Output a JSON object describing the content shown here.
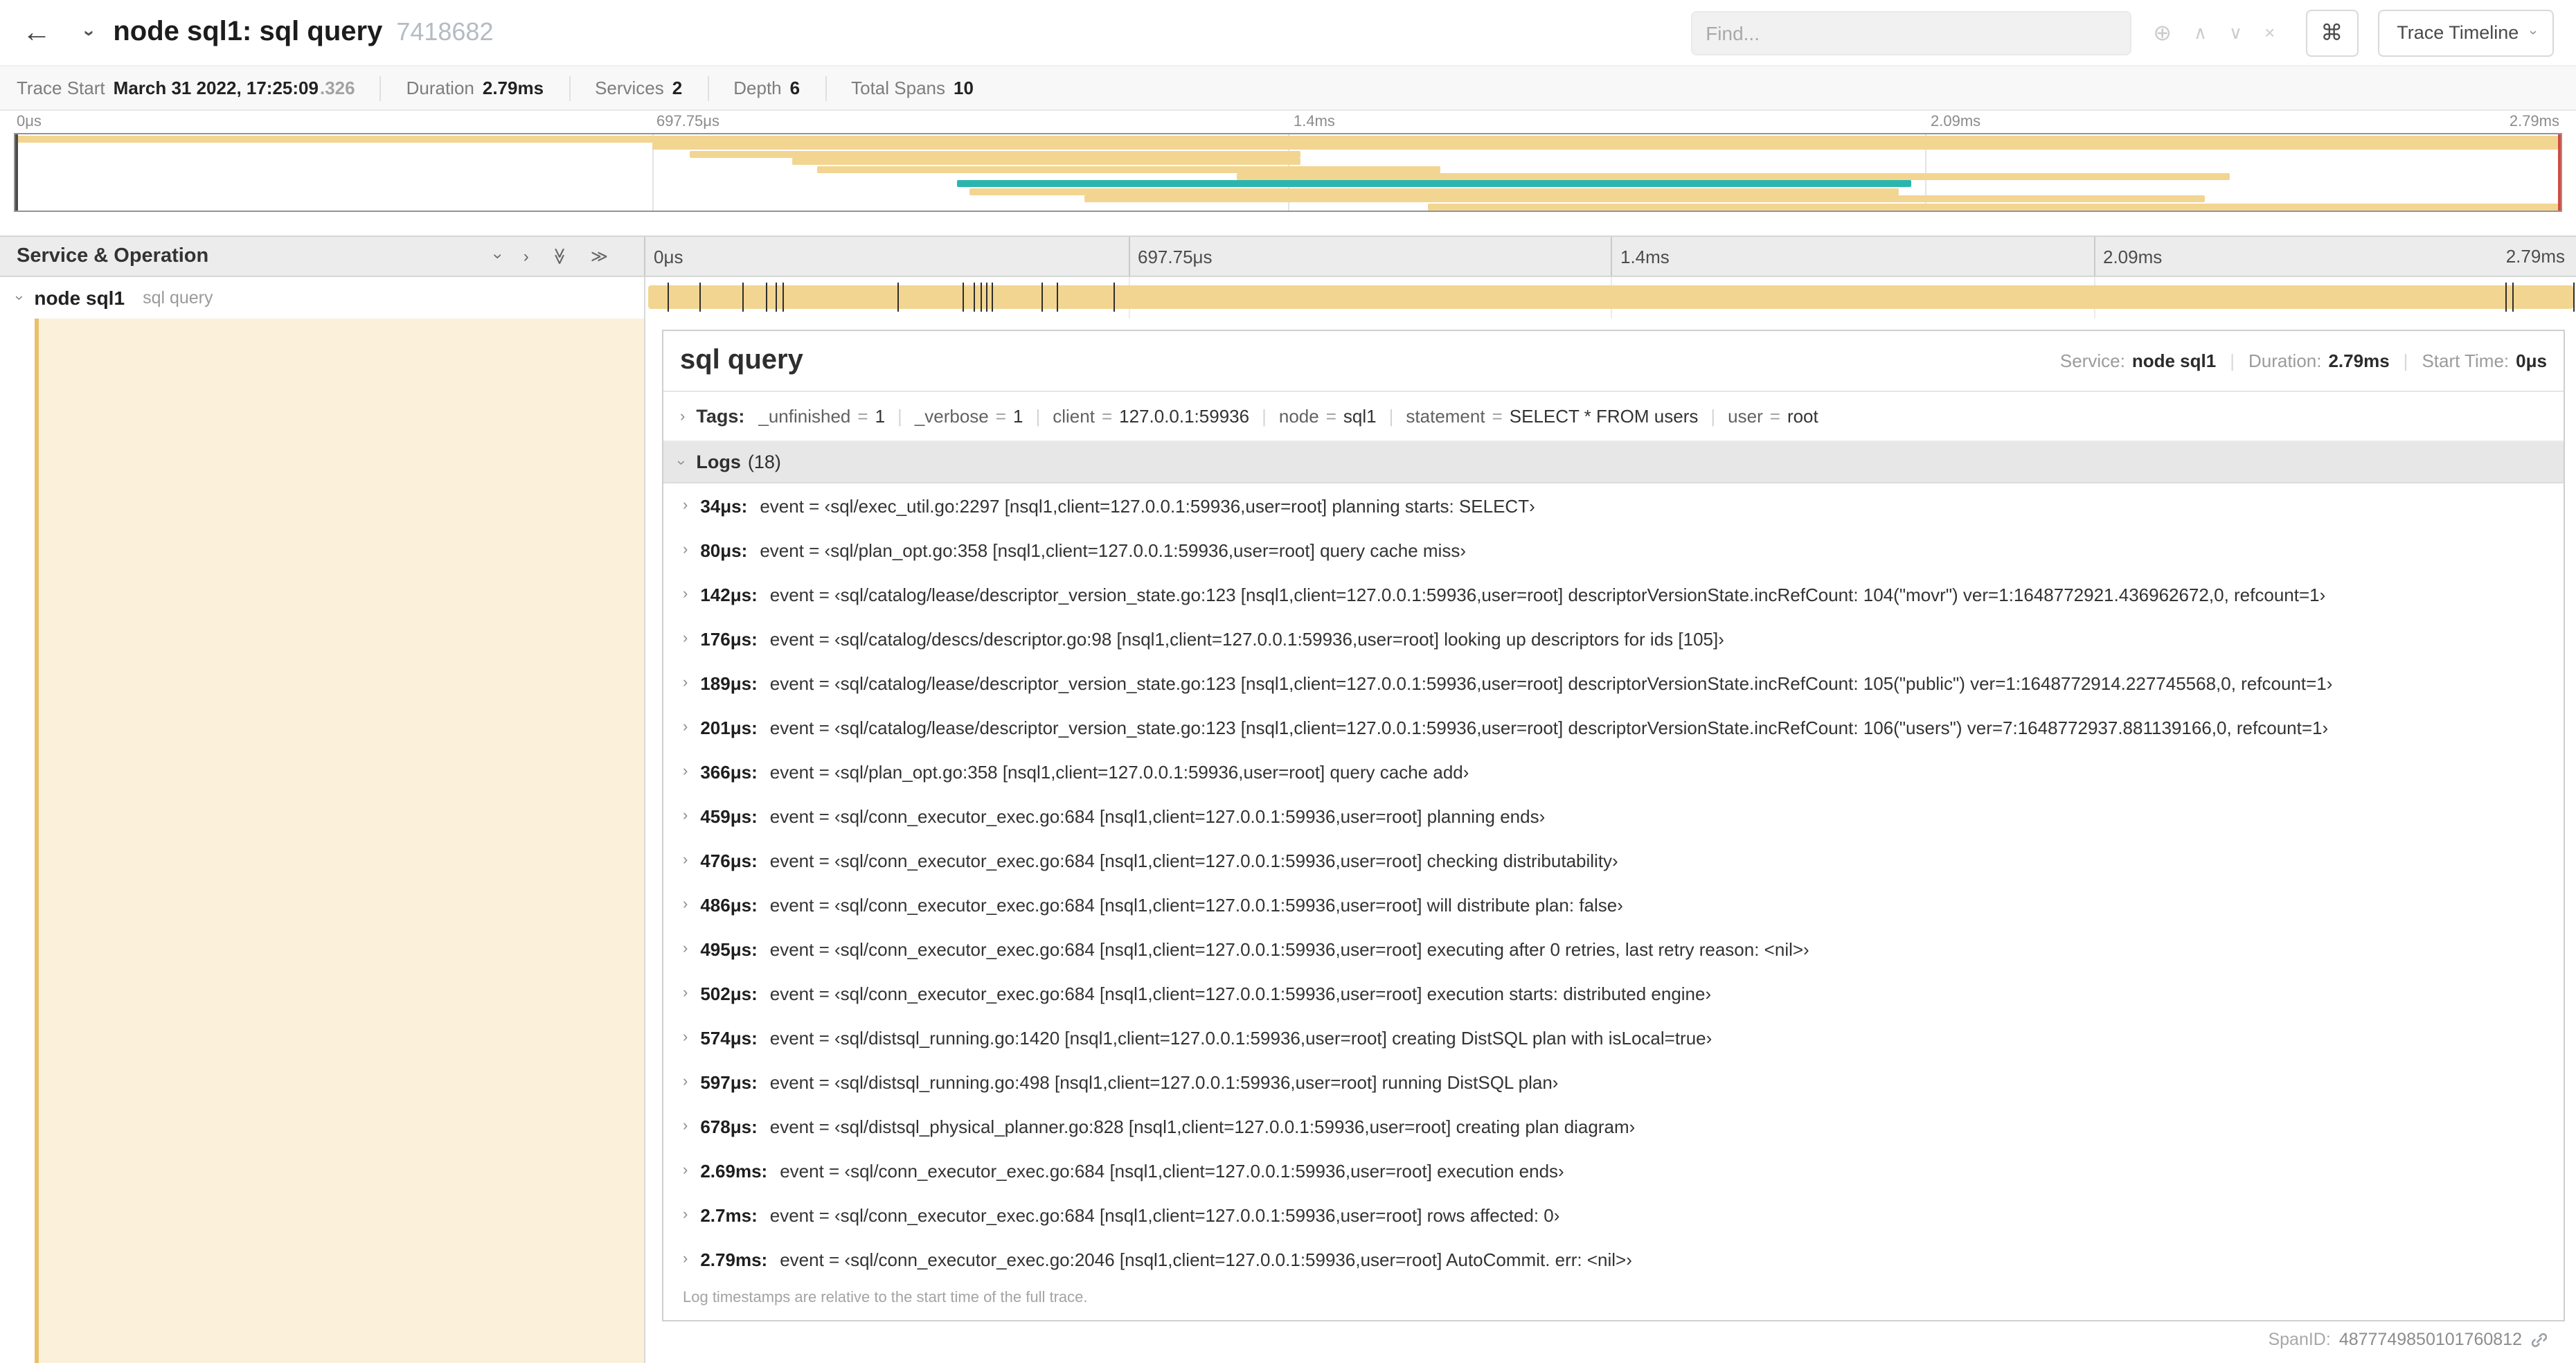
{
  "colors": {
    "tan": "#F2D591",
    "teal": "#2AB6AE",
    "cream": "#FBF1DA",
    "accent": "#E9C06A",
    "tick": "#2e2e2e"
  },
  "icons": {
    "back": "←",
    "chevron": "›",
    "double_chevron": "≫",
    "locate": "⊕",
    "prev": "∧",
    "next": "∨",
    "clear": "×",
    "keyboard": "⌘"
  },
  "header": {
    "title": "node sql1: sql query",
    "trace_id": "7418682",
    "find_placeholder": "Find...",
    "view_button": "Trace Timeline"
  },
  "summary": {
    "items": [
      {
        "label": "Trace Start",
        "value": "March 31 2022, 17:25:09",
        "suffix": ".326"
      },
      {
        "label": "Duration",
        "value": "2.79ms"
      },
      {
        "label": "Services",
        "value": "2"
      },
      {
        "label": "Depth",
        "value": "6"
      },
      {
        "label": "Total Spans",
        "value": "10"
      }
    ]
  },
  "minimap": {
    "ticks": [
      "0μs",
      "697.75μs",
      "1.4ms",
      "2.09ms",
      "2.79ms"
    ],
    "spans": [
      {
        "start": 0,
        "end": 100,
        "color": "tan"
      },
      {
        "start": 25,
        "end": 100,
        "color": "tan"
      },
      {
        "start": 26.5,
        "end": 50.5,
        "color": "tan"
      },
      {
        "start": 30.5,
        "end": 50.5,
        "color": "tan"
      },
      {
        "start": 31.5,
        "end": 56,
        "color": "tan"
      },
      {
        "start": 48,
        "end": 87,
        "color": "tan"
      },
      {
        "start": 37,
        "end": 74.5,
        "color": "teal"
      },
      {
        "start": 37.5,
        "end": 74,
        "color": "tan"
      },
      {
        "start": 42,
        "end": 86,
        "color": "tan"
      },
      {
        "start": 55.5,
        "end": 100,
        "color": "tan"
      }
    ]
  },
  "timeline": {
    "header_label": "Service & Operation",
    "ticks": [
      "0μs",
      "697.75μs",
      "1.4ms",
      "2.09ms",
      "2.79ms"
    ],
    "row": {
      "service": "node sql1",
      "operation": "sql query"
    },
    "log_marks": [
      1.2,
      2.9,
      5.1,
      6.3,
      6.8,
      7.2,
      13.1,
      16.5,
      17.1,
      17.4,
      17.7,
      18,
      20.6,
      21.4,
      24.3,
      96.4,
      96.8,
      99.9
    ]
  },
  "detail": {
    "title": "sql query",
    "overview": [
      {
        "label": "Service:",
        "value": "node sql1"
      },
      {
        "label": "Duration:",
        "value": "2.79ms"
      },
      {
        "label": "Start Time:",
        "value": "0μs"
      }
    ],
    "tags_label": "Tags:",
    "tags": [
      {
        "key": "_unfinished",
        "value": "1"
      },
      {
        "key": "_verbose",
        "value": "1"
      },
      {
        "key": "client",
        "value": "127.0.0.1:59936"
      },
      {
        "key": "node",
        "value": "sql1"
      },
      {
        "key": "statement",
        "value": "SELECT * FROM users"
      },
      {
        "key": "user",
        "value": "root"
      }
    ],
    "logs_label": "Logs",
    "logs_count": "(18)",
    "logs": [
      {
        "time": "34μs:",
        "message": "event = ‹sql/exec_util.go:2297 [nsql1,client=127.0.0.1:59936,user=root] planning starts: SELECT›"
      },
      {
        "time": "80μs:",
        "message": "event = ‹sql/plan_opt.go:358 [nsql1,client=127.0.0.1:59936,user=root] query cache miss›"
      },
      {
        "time": "142μs:",
        "message": "event = ‹sql/catalog/lease/descriptor_version_state.go:123 [nsql1,client=127.0.0.1:59936,user=root] descriptorVersionState.incRefCount: 104(\"movr\") ver=1:1648772921.436962672,0, refcount=1›"
      },
      {
        "time": "176μs:",
        "message": "event = ‹sql/catalog/descs/descriptor.go:98 [nsql1,client=127.0.0.1:59936,user=root] looking up descriptors for ids [105]›"
      },
      {
        "time": "189μs:",
        "message": "event = ‹sql/catalog/lease/descriptor_version_state.go:123 [nsql1,client=127.0.0.1:59936,user=root] descriptorVersionState.incRefCount: 105(\"public\") ver=1:1648772914.227745568,0, refcount=1›"
      },
      {
        "time": "201μs:",
        "message": "event = ‹sql/catalog/lease/descriptor_version_state.go:123 [nsql1,client=127.0.0.1:59936,user=root] descriptorVersionState.incRefCount: 106(\"users\") ver=7:1648772937.881139166,0, refcount=1›"
      },
      {
        "time": "366μs:",
        "message": "event = ‹sql/plan_opt.go:358 [nsql1,client=127.0.0.1:59936,user=root] query cache add›"
      },
      {
        "time": "459μs:",
        "message": "event = ‹sql/conn_executor_exec.go:684 [nsql1,client=127.0.0.1:59936,user=root] planning ends›"
      },
      {
        "time": "476μs:",
        "message": "event = ‹sql/conn_executor_exec.go:684 [nsql1,client=127.0.0.1:59936,user=root] checking distributability›"
      },
      {
        "time": "486μs:",
        "message": "event = ‹sql/conn_executor_exec.go:684 [nsql1,client=127.0.0.1:59936,user=root] will distribute plan: false›"
      },
      {
        "time": "495μs:",
        "message": "event = ‹sql/conn_executor_exec.go:684 [nsql1,client=127.0.0.1:59936,user=root] executing after 0 retries, last retry reason: <nil>›"
      },
      {
        "time": "502μs:",
        "message": "event = ‹sql/conn_executor_exec.go:684 [nsql1,client=127.0.0.1:59936,user=root] execution starts: distributed engine›"
      },
      {
        "time": "574μs:",
        "message": "event = ‹sql/distsql_running.go:1420 [nsql1,client=127.0.0.1:59936,user=root] creating DistSQL plan with isLocal=true›"
      },
      {
        "time": "597μs:",
        "message": "event = ‹sql/distsql_running.go:498 [nsql1,client=127.0.0.1:59936,user=root] running DistSQL plan›"
      },
      {
        "time": "678μs:",
        "message": "event = ‹sql/distsql_physical_planner.go:828 [nsql1,client=127.0.0.1:59936,user=root] creating plan diagram›"
      },
      {
        "time": "2.69ms:",
        "message": "event = ‹sql/conn_executor_exec.go:684 [nsql1,client=127.0.0.1:59936,user=root] execution ends›"
      },
      {
        "time": "2.7ms:",
        "message": "event = ‹sql/conn_executor_exec.go:684 [nsql1,client=127.0.0.1:59936,user=root] rows affected: 0›"
      },
      {
        "time": "2.79ms:",
        "message": "event = ‹sql/conn_executor_exec.go:2046 [nsql1,client=127.0.0.1:59936,user=root] AutoCommit. err: <nil>›"
      }
    ],
    "footnote": "Log timestamps are relative to the start time of the full trace.",
    "span_id_label": "SpanID:",
    "span_id": "4877749850101760812"
  }
}
